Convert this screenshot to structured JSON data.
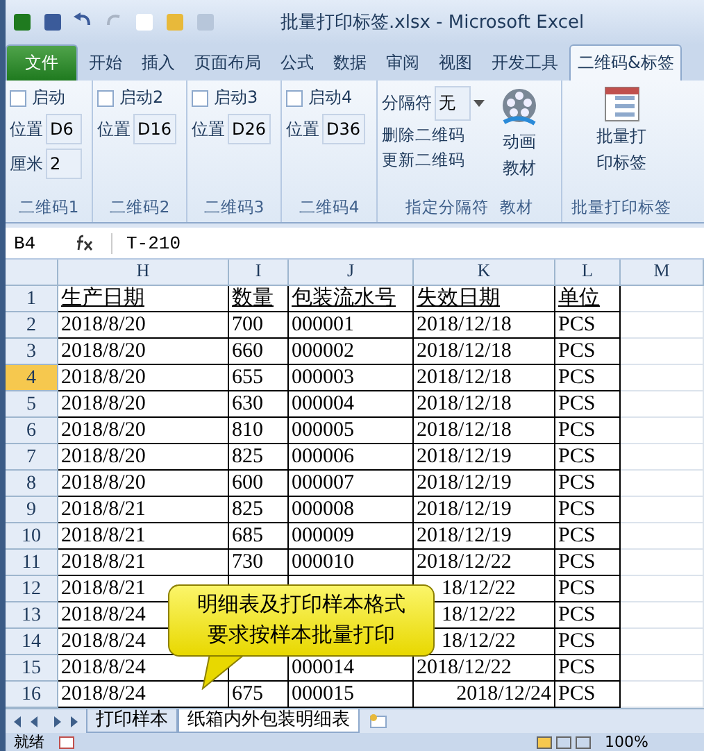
{
  "window": {
    "title": "批量打印标签.xlsx  -  Microsoft Excel"
  },
  "tabs": [
    {
      "label": "文件",
      "kind": "file",
      "selected": false
    },
    {
      "label": "开始",
      "kind": "tab",
      "selected": false
    },
    {
      "label": "插入",
      "kind": "tab",
      "selected": false
    },
    {
      "label": "页面布局",
      "kind": "tab",
      "selected": false
    },
    {
      "label": "公式",
      "kind": "tab",
      "selected": false
    },
    {
      "label": "数据",
      "kind": "tab",
      "selected": false
    },
    {
      "label": "审阅",
      "kind": "tab",
      "selected": false
    },
    {
      "label": "视图",
      "kind": "tab",
      "selected": false
    },
    {
      "label": "开发工具",
      "kind": "tab",
      "selected": false
    },
    {
      "label": "二维码&标签",
      "kind": "tab",
      "selected": true
    }
  ],
  "ribbon": {
    "groups": [
      {
        "kind": "qr",
        "label": "二维码1",
        "checkbox": {
          "label": "启动",
          "checked": false
        },
        "fields": [
          {
            "label": "位置",
            "value": "D6"
          },
          {
            "label": "厘米",
            "value": "2"
          }
        ]
      },
      {
        "kind": "qr",
        "label": "二维码2",
        "checkbox": {
          "label": "启动2",
          "checked": false
        },
        "fields": [
          {
            "label": "位置",
            "value": "D16"
          }
        ]
      },
      {
        "kind": "qr",
        "label": "二维码3",
        "checkbox": {
          "label": "启动3",
          "checked": false
        },
        "fields": [
          {
            "label": "位置",
            "value": "D26"
          }
        ]
      },
      {
        "kind": "qr",
        "label": "二维码4",
        "checkbox": {
          "label": "启动4",
          "checked": false
        },
        "fields": [
          {
            "label": "位置",
            "value": "D36"
          }
        ]
      },
      {
        "kind": "separator",
        "label": "指定分隔符",
        "second_label": "教材",
        "select": {
          "label": "分隔符",
          "value": "无"
        },
        "links": [
          "删除二维码",
          "更新二维码"
        ],
        "button": [
          "动画",
          "教材"
        ]
      },
      {
        "kind": "big",
        "label": "批量打印标签",
        "button": [
          "批量打",
          "印标签"
        ]
      }
    ]
  },
  "formula_bar": {
    "name_box": "B4",
    "formula": "T-210"
  },
  "sheet": {
    "columns": [
      "H",
      "I",
      "J",
      "K",
      "L",
      "M"
    ],
    "rows": [
      {
        "number": "1",
        "selected": false,
        "cells": [
          "生产日期",
          "数量",
          "包装流水号",
          "失效日期",
          "单位"
        ]
      },
      {
        "number": "2",
        "selected": false,
        "cells": [
          "2018/8/20",
          "700",
          "000001",
          "2018/12/18",
          "PCS"
        ]
      },
      {
        "number": "3",
        "selected": false,
        "cells": [
          "2018/8/20",
          "660",
          "000002",
          "2018/12/18",
          "PCS"
        ]
      },
      {
        "number": "4",
        "selected": true,
        "cells": [
          "2018/8/20",
          "655",
          "000003",
          "2018/12/18",
          "PCS"
        ]
      },
      {
        "number": "5",
        "selected": false,
        "cells": [
          "2018/8/20",
          "630",
          "000004",
          "2018/12/18",
          "PCS"
        ]
      },
      {
        "number": "6",
        "selected": false,
        "cells": [
          "2018/8/20",
          "810",
          "000005",
          "2018/12/18",
          "PCS"
        ]
      },
      {
        "number": "7",
        "selected": false,
        "cells": [
          "2018/8/20",
          "825",
          "000006",
          "2018/12/19",
          "PCS"
        ]
      },
      {
        "number": "8",
        "selected": false,
        "cells": [
          "2018/8/20",
          "600",
          "000007",
          "2018/12/19",
          "PCS"
        ]
      },
      {
        "number": "9",
        "selected": false,
        "cells": [
          "2018/8/21",
          "825",
          "000008",
          "2018/12/19",
          "PCS"
        ]
      },
      {
        "number": "10",
        "selected": false,
        "cells": [
          "2018/8/21",
          "685",
          "000009",
          "2018/12/19",
          "PCS"
        ]
      },
      {
        "number": "11",
        "selected": false,
        "cells": [
          "2018/8/21",
          "730",
          "000010",
          "2018/12/22",
          "PCS"
        ]
      },
      {
        "number": "12",
        "selected": false,
        "cells": [
          "2018/8/21",
          null,
          null,
          {
            "text": "18/12/22",
            "partly_covered": true
          },
          "PCS"
        ]
      },
      {
        "number": "13",
        "selected": false,
        "cells": [
          "2018/8/24",
          null,
          null,
          {
            "text": "18/12/22",
            "partly_covered": true
          },
          "PCS"
        ]
      },
      {
        "number": "14",
        "selected": false,
        "cells": [
          "2018/8/24",
          null,
          null,
          {
            "text": "18/12/22",
            "partly_covered": true
          },
          "PCS"
        ]
      },
      {
        "number": "15",
        "selected": false,
        "cells": [
          "2018/8/24",
          null,
          "000014",
          "2018/12/22",
          "PCS"
        ]
      },
      {
        "number": "16",
        "selected": false,
        "cells": [
          "2018/8/24",
          "675",
          "000015",
          {
            "text": "2018/12/24",
            "right_aligned": true
          },
          "PCS"
        ]
      }
    ]
  },
  "callout": {
    "lines": [
      "明细表及打印样本格式",
      "要求按样本批量打印"
    ]
  },
  "sheet_tabs": [
    {
      "label": "打印样本",
      "selected": false
    },
    {
      "label": "纸箱内外包装明细表",
      "selected": true
    }
  ],
  "status_bar": {
    "status": "就绪",
    "zoom": "100%"
  }
}
